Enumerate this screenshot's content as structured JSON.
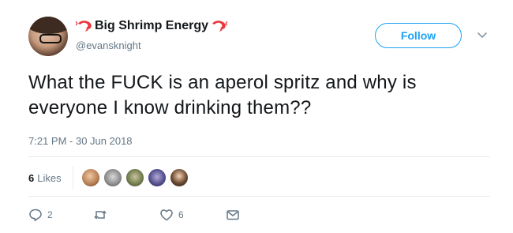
{
  "user": {
    "display_name": "Big Shrimp Energy",
    "handle": "@evansknight",
    "emoji_left": "shrimp-icon",
    "emoji_right": "shrimp-icon"
  },
  "follow_label": "Follow",
  "tweet": {
    "text": "What the FUCK is an aperol spritz and why is everyone I know drinking them??",
    "timestamp": "7:21 PM - 30 Jun 2018"
  },
  "likes": {
    "count": "6",
    "label": "Likes"
  },
  "actions": {
    "reply_count": "2",
    "retweet_count": "",
    "like_count": "6"
  },
  "colors": {
    "accent": "#1da1f2",
    "muted": "#657786",
    "divider": "#e6ecf0",
    "text": "#14171a"
  }
}
